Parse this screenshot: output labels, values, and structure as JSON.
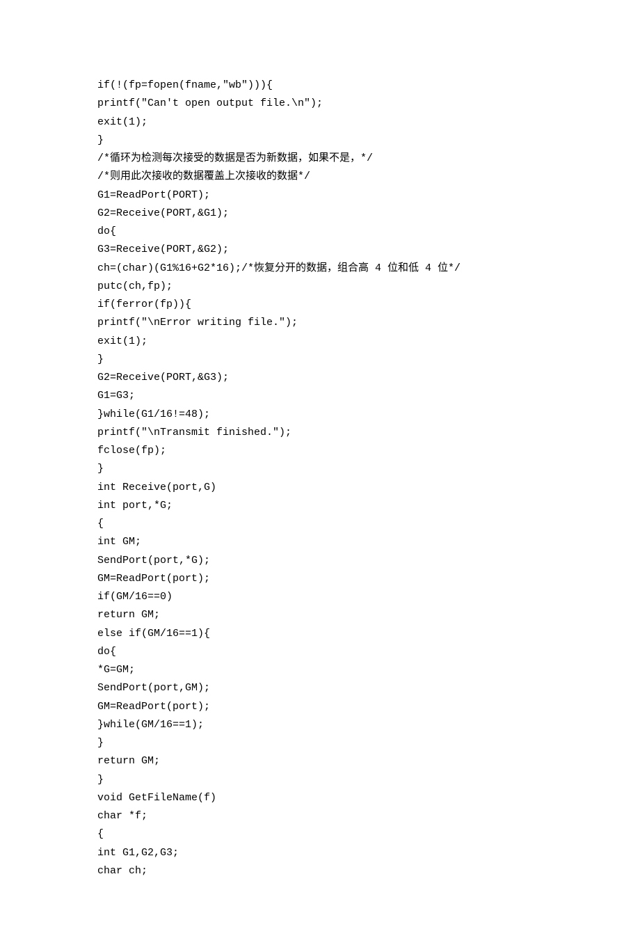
{
  "code": {
    "lines": [
      "if(!(fp=fopen(fname,\"wb\"))){",
      "printf(\"Can't open output file.\\n\");",
      "exit(1);",
      "}",
      "/*循环为检测每次接受的数据是否为新数据，如果不是，*/",
      "/*则用此次接收的数据覆盖上次接收的数据*/",
      "G1=ReadPort(PORT);",
      "G2=Receive(PORT,&G1);",
      "do{",
      "G3=Receive(PORT,&G2);",
      "ch=(char)(G1%16+G2*16);/*恢复分开的数据，组合高 4 位和低 4 位*/",
      "putc(ch,fp);",
      "if(ferror(fp)){",
      "printf(\"\\nError writing file.\");",
      "exit(1);",
      "}",
      "G2=Receive(PORT,&G3);",
      "G1=G3;",
      "}while(G1/16!=48);",
      "printf(\"\\nTransmit finished.\");",
      "fclose(fp);",
      "}",
      "int Receive(port,G)",
      "int port,*G;",
      "{",
      "int GM;",
      "SendPort(port,*G);",
      "GM=ReadPort(port);",
      "if(GM/16==0)",
      "return GM;",
      "else if(GM/16==1){",
      "do{",
      "*G=GM;",
      "SendPort(port,GM);",
      "GM=ReadPort(port);",
      "}while(GM/16==1);",
      "}",
      "return GM;",
      "}",
      "void GetFileName(f)",
      "char *f;",
      "{",
      "int G1,G2,G3;",
      "char ch;"
    ]
  }
}
